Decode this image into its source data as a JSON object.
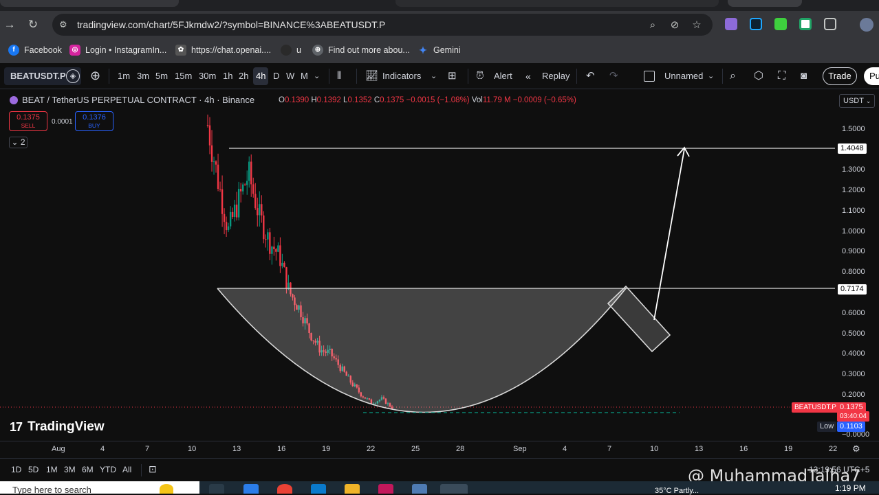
{
  "browser": {
    "url_host": "tradingview.com",
    "url_path": "/chart/5FJkmdw2/?symbol=BINANCE%3ABEATUSDT.P",
    "bookmarks": [
      {
        "label": "Facebook",
        "icon": "facebook-icon",
        "color": "#1877f2",
        "glyph": "f"
      },
      {
        "label": "Login • InstagramIn...",
        "icon": "instagram-icon",
        "color": "#d6249f",
        "glyph": "◎"
      },
      {
        "label": "https://chat.openai....",
        "icon": "openai-icon",
        "color": "#555555",
        "glyph": "✿"
      },
      {
        "label": "u",
        "icon": "u-icon",
        "color": "#2a2a2a",
        "glyph": ""
      },
      {
        "label": "Find out more abou...",
        "icon": "globe-icon",
        "color": "#5f6368",
        "glyph": "⊕"
      },
      {
        "label": "Gemini",
        "icon": "gemini-icon",
        "color": "#4285f4",
        "glyph": "✦"
      }
    ]
  },
  "toolbar": {
    "symbol": "BEATUSDT.P",
    "timeframes": [
      "1m",
      "3m",
      "5m",
      "15m",
      "30m",
      "1h",
      "2h",
      "4h",
      "D",
      "W",
      "M"
    ],
    "active_timeframe": "4h",
    "indicators_label": "Indicators",
    "alert_label": "Alert",
    "replay_label": "Replay",
    "layout_name": "Unnamed",
    "trade_label": "Trade",
    "publish_label": "Pu"
  },
  "legend": {
    "title": "BEAT / TetherUS PERPETUAL CONTRACT · 4h · Binance",
    "o_label": "O",
    "o": "0.1390",
    "h_label": "H",
    "h": "0.1392",
    "l_label": "L",
    "l": "0.1352",
    "c_label": "C",
    "c": "0.1375",
    "change": "−0.0015 (−1.08%)",
    "vol_label": "Vol",
    "vol": "11.79 M",
    "vol_change": "−0.0009 (−0.65%)",
    "sell_price": "0.1375",
    "sell_label": "SELL",
    "buy_price": "0.1376",
    "buy_label": "BUY",
    "spread": "0.0001",
    "indicators_count": "2"
  },
  "price_scale": {
    "currency": "USDT",
    "labels": [
      "1.5000",
      "1.3000",
      "1.2000",
      "1.1000",
      "1.0000",
      "0.9000",
      "0.8000",
      "0.6000",
      "0.5000",
      "0.4000",
      "0.3000",
      "0.2000",
      "−0.0000"
    ],
    "target_level": "1.4048",
    "neckline_level": "0.7174",
    "symbol_tag": "BEATUSDT.P",
    "last_price": "0.1375",
    "countdown": "03:40:04",
    "low_label": "Low",
    "low_value": "0.1103"
  },
  "time_axis": {
    "labels": [
      "Aug",
      "4",
      "7",
      "10",
      "13",
      "16",
      "19",
      "22",
      "25",
      "28",
      "Sep",
      "4",
      "7",
      "10",
      "13",
      "16",
      "19",
      "22"
    ]
  },
  "branding": {
    "logo_text": "TradingView",
    "logo_mark": "17"
  },
  "bottom": {
    "ranges": [
      "1D",
      "5D",
      "1M",
      "3M",
      "6M",
      "YTD",
      "All"
    ],
    "clock": "13:19:56 UTC+5"
  },
  "watermark": "@ MuhammadTalha7",
  "taskbar": {
    "search_placeholder": "Type here to search",
    "weather": "35°C  Partly...",
    "time": "1:19 PM"
  },
  "colors": {
    "bull": "#089981",
    "bear": "#f23645",
    "accent": "#2962ff",
    "drawing": "#d9d9d9"
  },
  "chart_data": {
    "type": "candlestick",
    "ylim": [
      0,
      1.55
    ],
    "close_path": [
      {
        "x": "Aug 11",
        "y": 1.52
      },
      {
        "x": "Aug 11",
        "y": 1.25
      },
      {
        "x": "Aug 12",
        "y": 1.0
      },
      {
        "x": "Aug 12",
        "y": 1.15
      },
      {
        "x": "Aug 13",
        "y": 1.28
      },
      {
        "x": "Aug 13",
        "y": 1.08
      },
      {
        "x": "Aug 14",
        "y": 0.95
      },
      {
        "x": "Aug 14",
        "y": 0.88
      },
      {
        "x": "Aug 15",
        "y": 0.7
      },
      {
        "x": "Aug 15",
        "y": 0.62
      },
      {
        "x": "Aug 16",
        "y": 0.5
      },
      {
        "x": "Aug 17",
        "y": 0.42
      },
      {
        "x": "Aug 18",
        "y": 0.4
      },
      {
        "x": "Aug 19",
        "y": 0.33
      },
      {
        "x": "Aug 20",
        "y": 0.26
      },
      {
        "x": "Aug 21",
        "y": 0.2
      },
      {
        "x": "Aug 22",
        "y": 0.16
      },
      {
        "x": "Aug 23",
        "y": 0.18
      },
      {
        "x": "Aug 23",
        "y": 0.1375
      }
    ],
    "horizontal_levels": [
      1.4048,
      0.7174
    ],
    "low": 0.1103,
    "last": 0.1375
  }
}
